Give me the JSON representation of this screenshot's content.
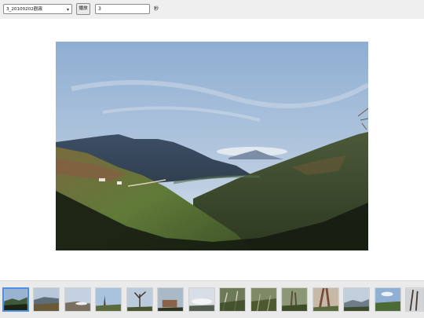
{
  "toolbar": {
    "album_selected": "3_20100202觀霧",
    "play_label": "播放",
    "interval_value": "3",
    "interval_unit": "秒"
  },
  "main_photo": {
    "alt_icon": "mountain-landscape-photo"
  },
  "thumbnail_strip": {
    "count_visible": 14,
    "active_index": 0
  }
}
